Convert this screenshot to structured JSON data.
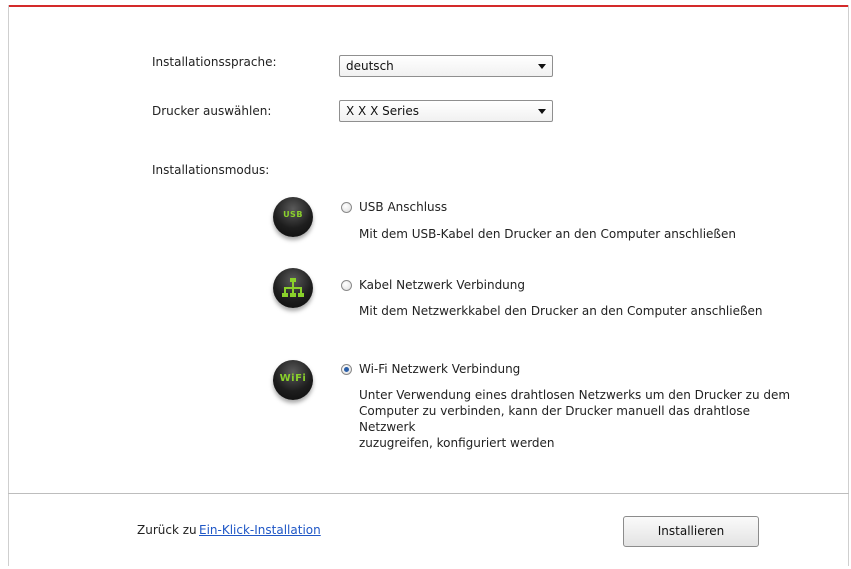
{
  "form": {
    "language_label": "Installationssprache:",
    "language_value": "deutsch",
    "printer_label": "Drucker auswählen:",
    "printer_value": "X X X  Series",
    "mode_label": "Installationsmodus:"
  },
  "modes": [
    {
      "icon": "usb-icon",
      "icon_text": "USB",
      "title": "USB Anschluss",
      "selected": false,
      "description": [
        "Mit dem USB-Kabel den Drucker an den Computer anschließen"
      ]
    },
    {
      "icon": "network-icon",
      "title": "Kabel Netzwerk Verbindung",
      "selected": false,
      "description": [
        "Mit dem Netzwerkkabel den Drucker an den Computer anschließen"
      ]
    },
    {
      "icon": "wifi-icon",
      "icon_text": "WiFi",
      "title": "Wi-Fi Netzwerk Verbindung",
      "selected": true,
      "description": [
        "Unter Verwendung eines drahtlosen Netzwerks um den Drucker zu dem",
        "Computer zu verbinden, kann der Drucker manuell das drahtlose Netzwerk",
        "zuzugreifen, konfiguriert werden"
      ]
    }
  ],
  "footer": {
    "back_label": "Zurück zu",
    "back_link": "Ein-Klick-Installation",
    "install_button": "Installieren"
  },
  "colors": {
    "accent_bar": "#d42a2a",
    "link": "#1f57c6",
    "icon_glyph": "#8ad12b"
  }
}
